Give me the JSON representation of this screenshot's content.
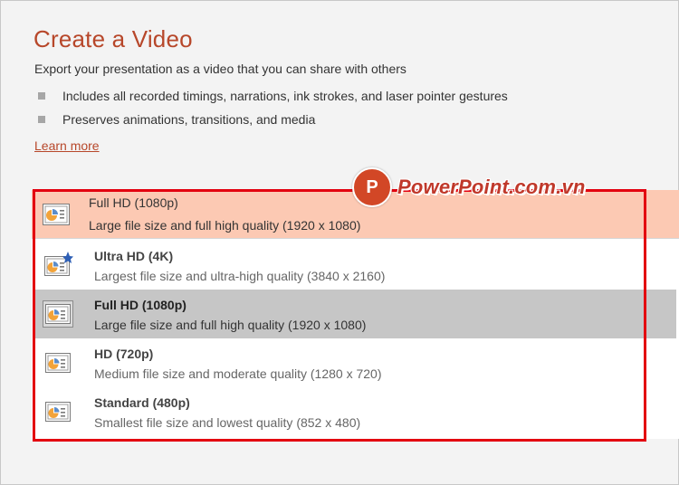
{
  "header": {
    "title": "Create a Video",
    "subtitle": "Export your presentation as a video that you can share with others",
    "bullets": [
      "Includes all recorded timings, narrations, ink strokes, and laser pointer gestures",
      "Preserves animations, transitions, and media"
    ],
    "learn_more": "Learn more"
  },
  "watermark": {
    "logo_letter": "P",
    "text": "PowerPoint.com.vn"
  },
  "quality_dropdown": {
    "selected": {
      "title": "Full HD (1080p)",
      "description": "Large file size and full high quality (1920 x 1080)"
    },
    "options": [
      {
        "title": "Ultra HD (4K)",
        "description": "Largest file size and ultra-high quality (3840 x 2160)",
        "icon": "slide-video-star-icon"
      },
      {
        "title": "Full HD (1080p)",
        "description": "Large file size and full high quality (1920 x 1080)",
        "icon": "slide-video-icon"
      },
      {
        "title": "HD (720p)",
        "description": "Medium file size and moderate quality (1280 x 720)",
        "icon": "slide-video-icon"
      },
      {
        "title": "Standard (480p)",
        "description": "Smallest file size and lowest quality (852 x 480)",
        "icon": "slide-video-icon"
      }
    ],
    "active_option": "Full HD (1080p)"
  },
  "colors": {
    "accent": "#b7472a",
    "selected_header_bg": "#fcc9b3",
    "active_option_bg": "#c6c6c6",
    "annotation_border": "#e3000f",
    "star": "#2e5fb5"
  }
}
